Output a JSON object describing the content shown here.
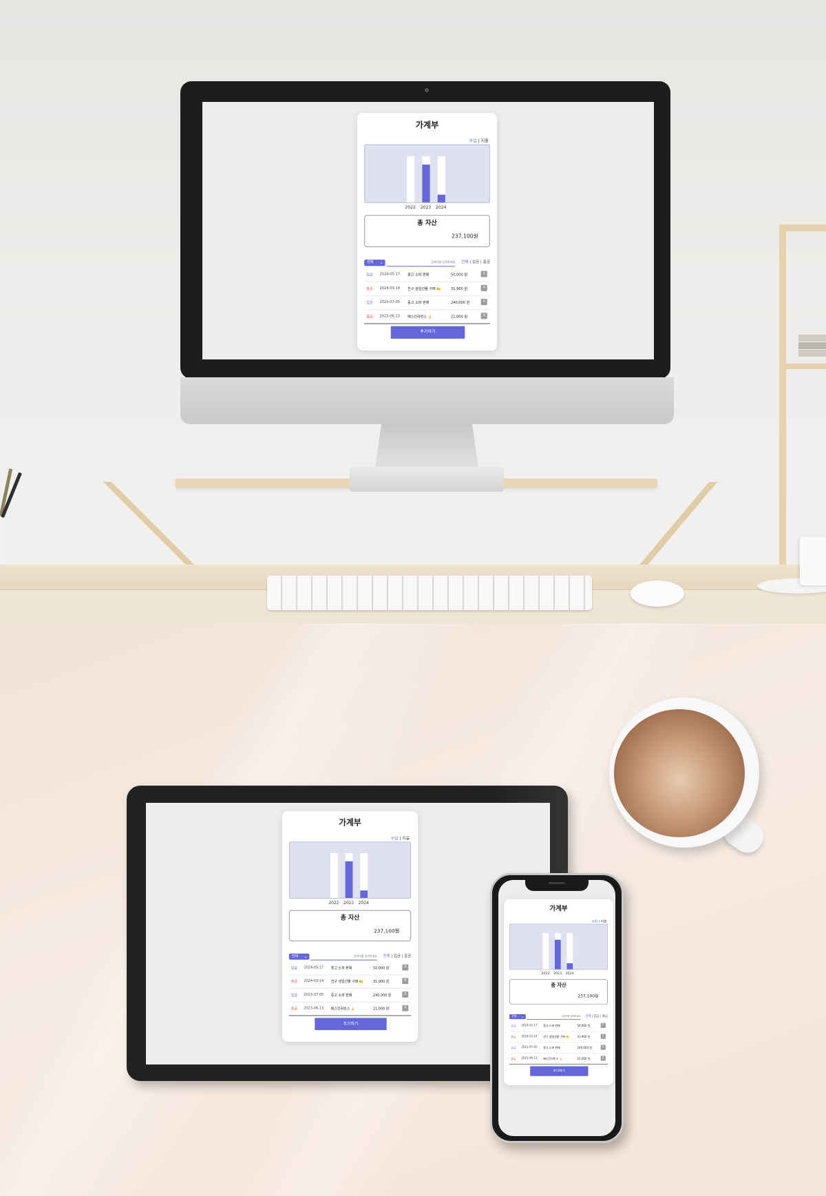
{
  "app": {
    "title": "가계부",
    "toggle": {
      "income": "수입",
      "sep": " | ",
      "expense": "지출"
    },
    "chart_data": {
      "type": "bar",
      "categories": [
        "2022",
        "2023",
        "2024"
      ],
      "values": [
        0,
        0.82,
        0.17
      ],
      "accent": "#6466db"
    },
    "asset": {
      "title": "총 자산",
      "value": "237,100원"
    },
    "filter": {
      "dropdown": "전체",
      "search_placeholder": "검색어를 입력하세요",
      "tabs": [
        "전체",
        "입금",
        "출금"
      ],
      "tab_sep": " | "
    },
    "transactions": [
      {
        "type": "입금",
        "kind": "in",
        "date": "2024-05-17",
        "desc": "중고 소파 판매",
        "amount": "50,000 원",
        "del": "X"
      },
      {
        "type": "출금",
        "kind": "out",
        "date": "2024-03-14",
        "desc": "친구 생일선물 구매 🍋",
        "amount": "31,900 원",
        "del": "X"
      },
      {
        "type": "입금",
        "kind": "in",
        "date": "2023-07-05",
        "desc": "중고 소파 판매",
        "amount": "240,000 원",
        "del": "X"
      },
      {
        "type": "출금",
        "kind": "out",
        "date": "2023-06-13",
        "desc": "배스킨라빈스 🍦",
        "amount": "21,000 원",
        "del": "X"
      }
    ],
    "add_button": "추가하기"
  },
  "colors": {
    "accent": "#6466db",
    "expense": "#e05a4a",
    "chart_bg": "#dfe0f0"
  }
}
